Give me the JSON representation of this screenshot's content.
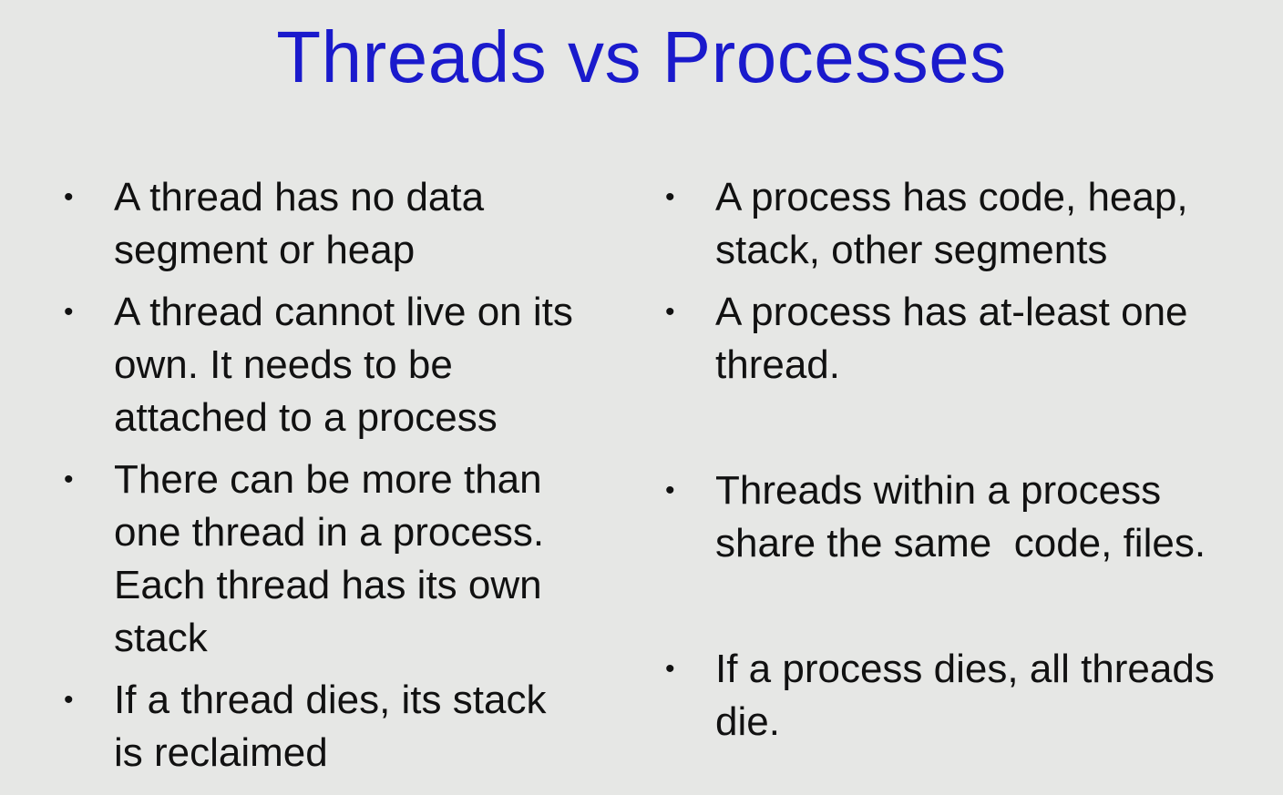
{
  "title": "Threads vs Processes",
  "left_bullets": [
    {
      "lines": [
        "A thread has no data",
        "segment or heap"
      ]
    },
    {
      "lines": [
        "A thread cannot live on its",
        "own. It needs to be",
        "attached to a process"
      ]
    },
    {
      "lines": [
        "There can be more than",
        "one thread in a process.",
        "Each thread has its own",
        "stack"
      ]
    },
    {
      "lines": [
        "If a thread dies, its stack",
        "is reclaimed"
      ]
    }
  ],
  "right_bullets": [
    {
      "lines": [
        "A process has code, heap,",
        "stack, other segments"
      ]
    },
    {
      "lines": [
        "A process has at-least one",
        "thread."
      ]
    },
    {
      "lines": [
        "Threads within a process",
        "share the same  code, files."
      ]
    },
    {
      "lines": [
        "If a process dies, all threads",
        "die."
      ]
    }
  ],
  "colors": {
    "title": "#1a1acc",
    "text": "#111111",
    "background": "#e6e7e5"
  }
}
